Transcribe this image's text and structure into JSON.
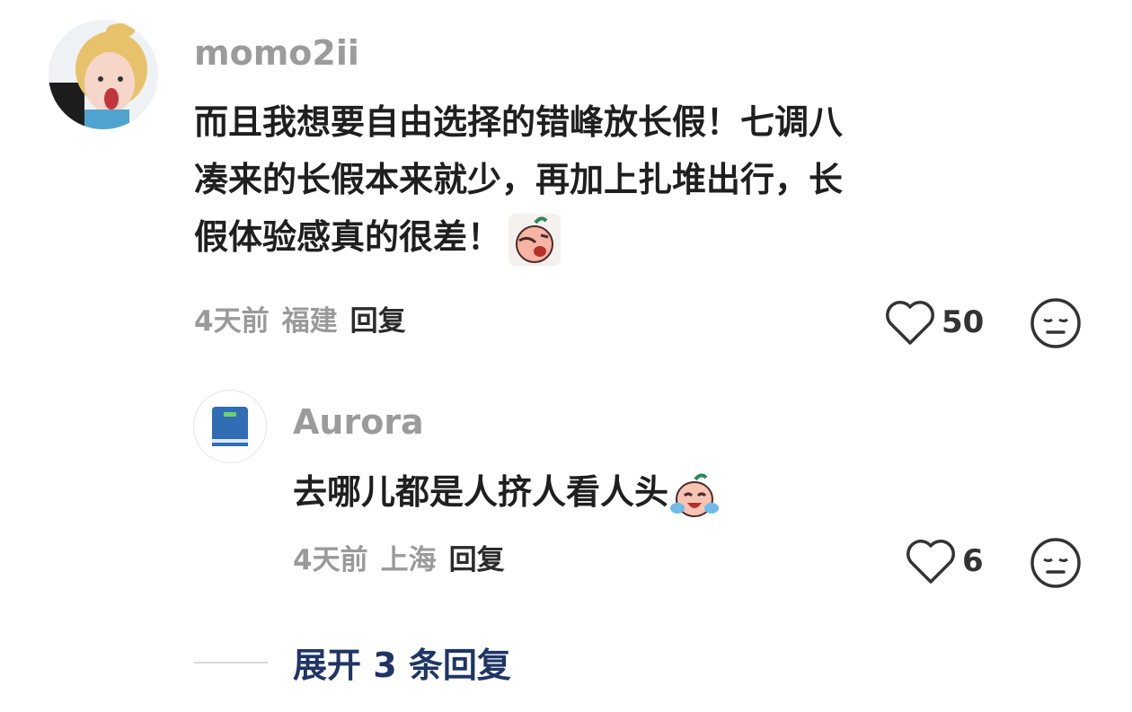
{
  "comment": {
    "username": "momo2ii",
    "text": "而且我想要自由选择的错峰放长假！七调八凑来的长假本来就少，再加上扎堆出行，长假体验感真的很差！",
    "lines": [
      "而且我想要自由选择的错峰放长假！七调八",
      "凑来的长假本来就少，再加上扎堆出行，长",
      "假体验感真的很差！"
    ],
    "emoji": "facepalm-cry-emoji",
    "time": "4天前",
    "location": "福建",
    "reply_label": "回复",
    "likes": "50"
  },
  "reply": {
    "username": "Aurora",
    "text": "去哪儿都是人挤人看人头",
    "emoji": "crying-laugh-emoji",
    "time": "4天前",
    "location": "上海",
    "reply_label": "回复",
    "likes": "6"
  },
  "expand_label": "展开 3 条回复",
  "colors": {
    "username": "#9b9b9b",
    "expand": "#1e3565",
    "text": "#1f1f1f"
  }
}
